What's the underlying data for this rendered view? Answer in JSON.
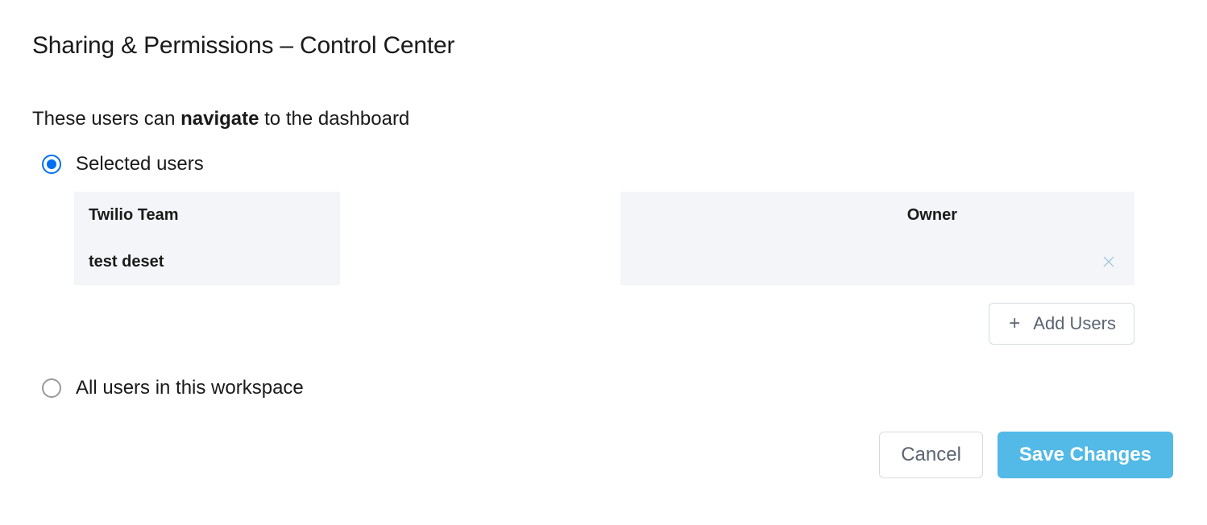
{
  "title": "Sharing & Permissions – Control Center",
  "description": {
    "prefix": "These users can ",
    "bold": "navigate",
    "suffix": " to the dashboard"
  },
  "options": {
    "selected_users_label": "Selected users",
    "all_users_label": "All users in this workspace"
  },
  "users": [
    {
      "name": "Twilio Team",
      "role": "Owner",
      "removable": false
    },
    {
      "name": "test deset",
      "role": "",
      "removable": true
    }
  ],
  "buttons": {
    "add_users": "Add Users",
    "cancel": "Cancel",
    "save": "Save Changes"
  }
}
